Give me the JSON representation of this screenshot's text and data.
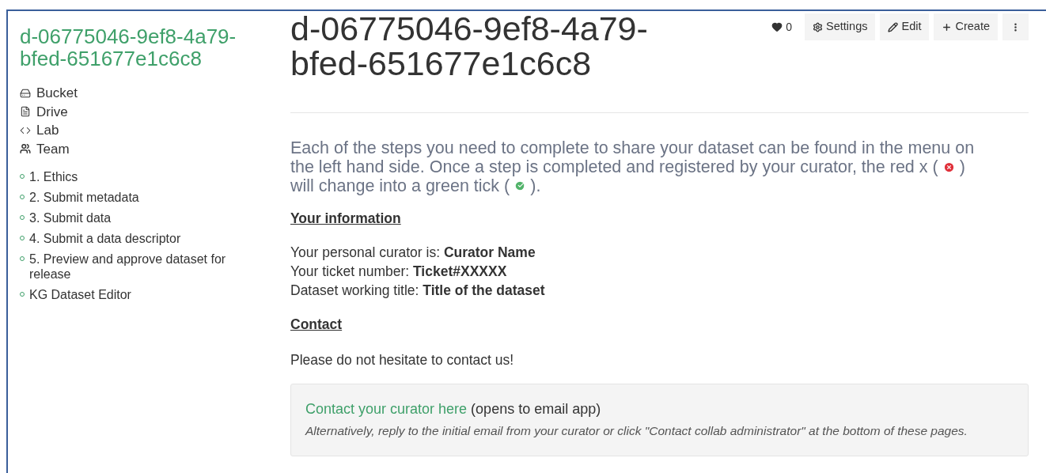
{
  "sidebar": {
    "title": "d-06775046-9ef8-4a79-bfed-651677e1c6c8",
    "tools": [
      {
        "kind": "bucket",
        "label": "Bucket"
      },
      {
        "kind": "drive",
        "label": "Drive"
      },
      {
        "kind": "lab",
        "label": "Lab"
      },
      {
        "kind": "team",
        "label": "Team"
      }
    ],
    "steps": [
      "1. Ethics",
      "2. Submit metadata",
      "3. Submit data",
      "4. Submit a data descriptor",
      "5. Preview and approve dataset for release",
      "KG Dataset Editor"
    ]
  },
  "header": {
    "title": "d-06775046-9ef8-4a79-bfed-651677e1c6c8",
    "likes": "0",
    "buttons": [
      {
        "kind": "settings",
        "label": "Settings"
      },
      {
        "kind": "edit",
        "label": "Edit"
      },
      {
        "kind": "create",
        "label": "Create"
      },
      {
        "kind": "more"
      }
    ]
  },
  "intro": {
    "first_line": "Each of the steps you need to complete to share your dataset can be found in the menu on",
    "before_cross": "the left hand side. Once a step is completed and registered by your curator, the red x (",
    "between": ")",
    "before_tick": "will change into a green tick (",
    "after": ")."
  },
  "info": {
    "heading": "Your information",
    "lines": [
      "Your personal curator is: **Curator Name**",
      "Your ticket number: **Ticket#XXXXX**",
      "Dataset working title: **Title of the dataset**"
    ]
  },
  "contact": {
    "heading": "Contact",
    "text": "Please do not hesitate to contact us!",
    "link": "Contact your curator here",
    "link_note": "(opens to email app)",
    "alternative": "Alternatively, reply to the initial email from your curator or click \"Contact collab administrator\" at the bottom of these pages."
  }
}
